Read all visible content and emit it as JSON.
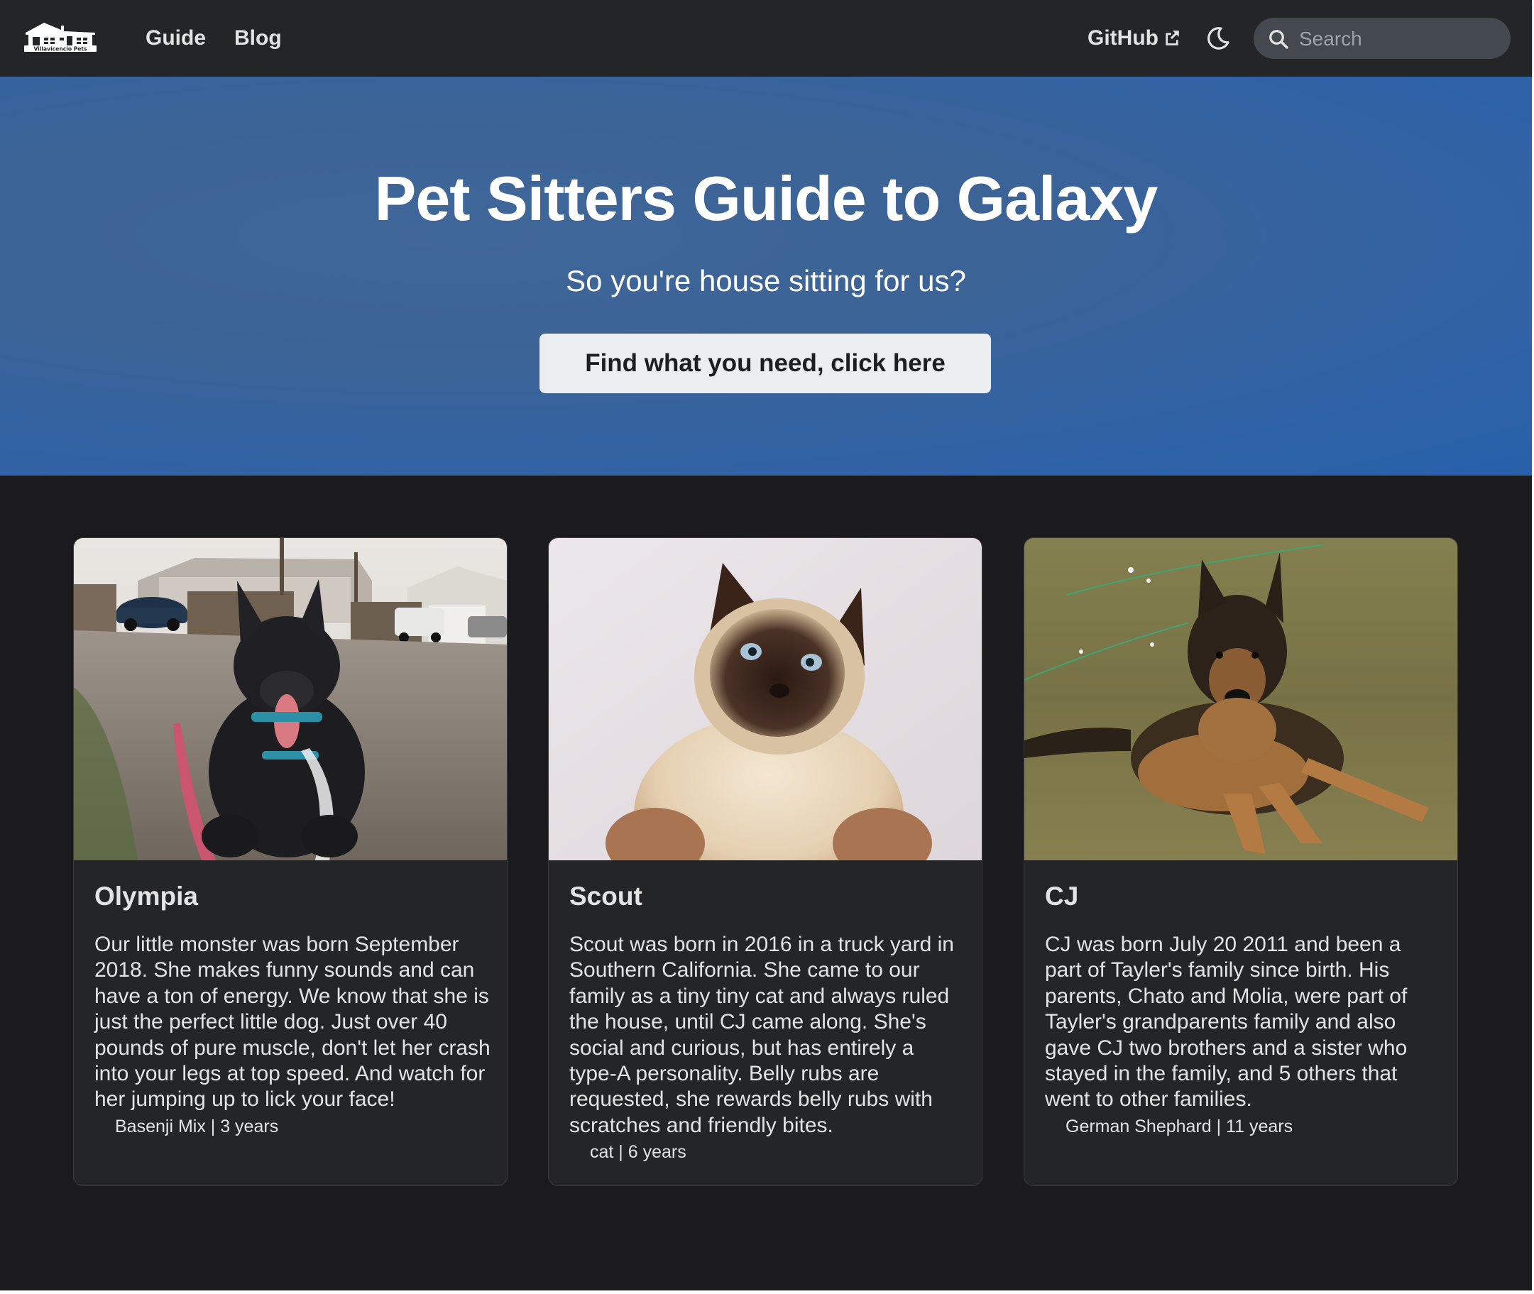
{
  "navbar": {
    "logo_text": "Villavicencio Pets",
    "links": [
      {
        "label": "Guide"
      },
      {
        "label": "Blog"
      }
    ],
    "github_label": "GitHub",
    "search_placeholder": "Search"
  },
  "hero": {
    "title": "Pet Sitters Guide to Galaxy",
    "subtitle": "So you're house sitting for us?",
    "button_label": "Find what you need, click here"
  },
  "pets": [
    {
      "name": "Olympia",
      "description": "Our little monster was born September 2018. She makes funny sounds and can have a ton of energy. We know that she is just the perfect little dog. Just over 40 pounds of pure muscle, don't let her crash into your legs at top speed. And watch for her jumping up to lick your face!",
      "meta": "Basenji Mix | 3 years"
    },
    {
      "name": "Scout",
      "description": "Scout was born in 2016 in a truck yard in Southern California. She came to our family as a tiny tiny cat and always ruled the house, until CJ came along. She's social and curious, but has entirely a type-A personality. Belly rubs are requested, she rewards belly rubs with scratches and friendly bites.",
      "meta": "cat | 6 years"
    },
    {
      "name": "CJ",
      "description": "CJ was born July 20 2011 and been a part of Tayler's family since birth. His parents, Chato and Molia, were part of Tayler's grandparents family and also gave CJ two brothers and a sister who stayed in the family, and 5 others that went to other families.",
      "meta": "German Shephard | 11 years"
    }
  ],
  "colors": {
    "navbar_bg": "#242526",
    "page_bg": "#1b1b1d",
    "hero_blue": "#2761ab",
    "card_bg": "#242526",
    "button_bg": "#ebedf0"
  }
}
